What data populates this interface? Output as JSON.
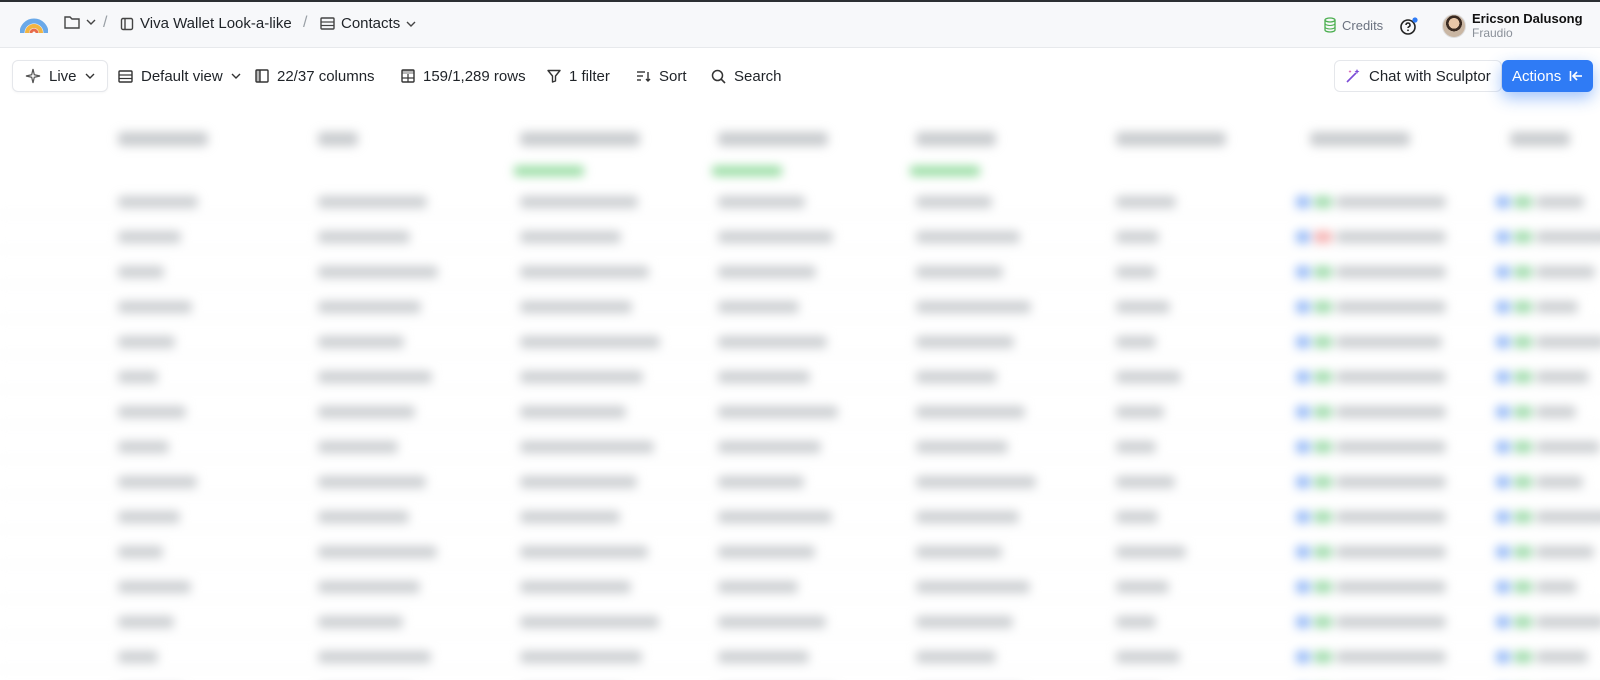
{
  "header": {
    "logo_icon": "rainbow-logo-icon",
    "folder_icon": "folder-icon",
    "project": "Viva Wallet Look-a-like",
    "table": "Contacts",
    "credits_label": "Credits",
    "help_icon": "help-icon",
    "user_name": "Ericson Dalusong",
    "user_org": "Fraudio"
  },
  "toolbar": {
    "live": "Live",
    "view": "Default view",
    "columns": "22/37 columns",
    "rows": "159/1,289 rows",
    "filter": "1 filter",
    "sort": "Sort",
    "search": "Search",
    "chat": "Chat with Sculptor",
    "actions": "Actions"
  },
  "colors": {
    "accent": "#2f7bf5",
    "header_bg": "#f7f8fa",
    "credits_icon": "#4caf50"
  }
}
